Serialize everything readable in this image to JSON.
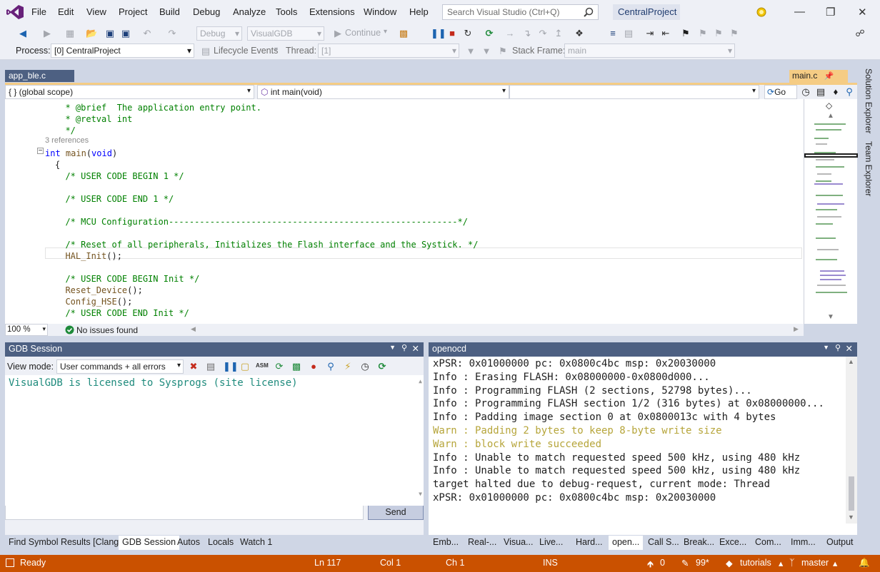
{
  "menu": [
    "File",
    "Edit",
    "View",
    "Project",
    "Build",
    "Debug",
    "Analyze",
    "Tools",
    "Extensions",
    "Window",
    "Help"
  ],
  "search": {
    "placeholder": "Search Visual Studio (Ctrl+Q)"
  },
  "project_badge": "CentralProject",
  "toolbar1": {
    "config": "Debug",
    "platform": "VisualGDB",
    "continue": "Continue"
  },
  "toolbar2": {
    "process_label": "Process:",
    "process_value": "[0] CentralProject",
    "lifecycle": "Lifecycle Events",
    "thread_label": "Thread:",
    "thread_value": "[1]",
    "stack_label": "Stack Frame:",
    "stack_value": "main"
  },
  "tabs": {
    "left": "app_ble.c",
    "right": "main.c"
  },
  "navbar": {
    "scope": "{ } (global scope)",
    "member": "int main(void)",
    "go": "Go"
  },
  "code": {
    "lines": [
      {
        "t": "  * @brief  The application entry point.",
        "c": "cm"
      },
      {
        "t": "  * @retval int",
        "c": "cm"
      },
      {
        "t": "  */",
        "c": "cm"
      },
      {
        "t": "int main(void)",
        "c": "sig"
      },
      {
        "t": "{",
        "c": "plain"
      },
      {
        "t": "  /* USER CODE BEGIN 1 */",
        "c": "cm"
      },
      {
        "t": "",
        "c": "plain"
      },
      {
        "t": "  /* USER CODE END 1 */",
        "c": "cm"
      },
      {
        "t": "",
        "c": "plain"
      },
      {
        "t": "  /* MCU Configuration--------------------------------------------------------*/",
        "c": "cm"
      },
      {
        "t": "",
        "c": "plain"
      },
      {
        "t": "  /* Reset of all peripherals, Initializes the Flash interface and the Systick. */",
        "c": "cm"
      },
      {
        "t": "  HAL_Init();",
        "c": "fn"
      },
      {
        "t": "",
        "c": "plain"
      },
      {
        "t": "  /* USER CODE BEGIN Init */",
        "c": "cm"
      },
      {
        "t": "  Reset_Device();",
        "c": "fn"
      },
      {
        "t": "  Config_HSE();",
        "c": "fn"
      },
      {
        "t": "  /* USER CODE END Init */",
        "c": "cm"
      }
    ],
    "references": "3 references"
  },
  "editor_status": {
    "zoom": "100 %",
    "issues": "No issues found"
  },
  "side_tabs": [
    "Solution Explorer",
    "Team Explorer"
  ],
  "gdb": {
    "title": "GDB Session",
    "view_mode_label": "View mode:",
    "view_mode_value": "User commands + all errors",
    "output": "VisualGDB is licensed to Sysprogs (site license)",
    "send": "Send"
  },
  "openocd": {
    "title": "openocd",
    "lines": [
      {
        "t": "xPSR: 0x01000000 pc: 0x0800c4bc msp: 0x20030000",
        "w": false
      },
      {
        "t": "Info : Erasing FLASH: 0x08000000-0x0800d000...",
        "w": false
      },
      {
        "t": "Info : Programming FLASH (2 sections, 52798 bytes)...",
        "w": false
      },
      {
        "t": "Info : Programming FLASH section 1/2 (316 bytes) at 0x08000000...",
        "w": false
      },
      {
        "t": "Info : Padding image section 0 at 0x0800013c with 4 bytes",
        "w": false
      },
      {
        "t": "Warn : Padding 2 bytes to keep 8-byte write size",
        "w": true
      },
      {
        "t": "Warn : block write succeeded",
        "w": true
      },
      {
        "t": "Info : Unable to match requested speed 500 kHz, using 480 kHz",
        "w": false
      },
      {
        "t": "Info : Unable to match requested speed 500 kHz, using 480 kHz",
        "w": false
      },
      {
        "t": "target halted due to debug-request, current mode: Thread",
        "w": false
      },
      {
        "t": "xPSR: 0x01000000 pc: 0x0800c4bc msp: 0x20030000",
        "w": false
      }
    ]
  },
  "left_bottom_tabs": [
    "Find Symbol Results [Clang]",
    "GDB Session",
    "Autos",
    "Locals",
    "Watch 1"
  ],
  "right_bottom_tabs": [
    "Emb...",
    "Real-...",
    "Visua...",
    "Live...",
    "Hard...",
    "open...",
    "Call S...",
    "Break...",
    "Exce...",
    "Com...",
    "Imm...",
    "Output"
  ],
  "status": {
    "ready": "Ready",
    "ln": "Ln 117",
    "col": "Col 1",
    "ch": "Ch 1",
    "ins": "INS",
    "up": "0",
    "pencil": "99*",
    "repo": "tutorials",
    "branch": "master"
  },
  "colors": {
    "accent": "#4d6082",
    "tab_active": "#f5cc84",
    "statusbar": "#ca5100",
    "comment": "#008000",
    "warn": "#b6a53a"
  }
}
